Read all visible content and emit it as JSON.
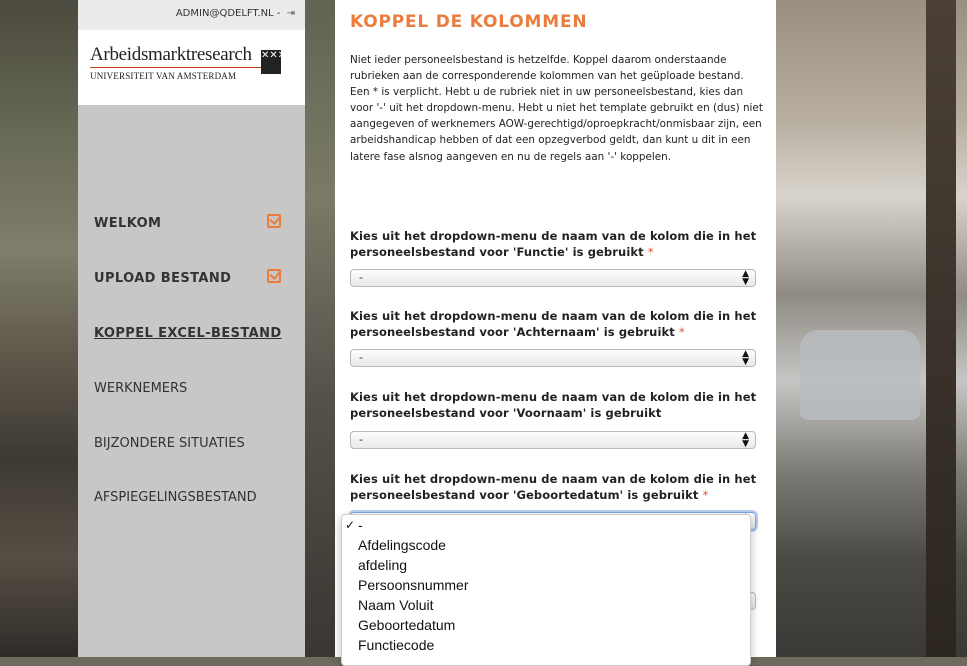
{
  "header": {
    "user": "ADMIN@QDELFT.NL -",
    "logout_icon": "logout-icon"
  },
  "logo": {
    "title": "Arbeidsmarktresearch",
    "subtitle": "UNIVERSITEIT VAN AMSTERDAM",
    "emblem": "✕✕✕"
  },
  "nav": {
    "items": [
      {
        "label": "WELKOM",
        "checked": true
      },
      {
        "label": "UPLOAD BESTAND",
        "checked": true
      },
      {
        "label": "KOPPEL EXCEL-BESTAND",
        "active": true
      },
      {
        "label": "WERKNEMERS"
      },
      {
        "label": "BIJZONDERE SITUATIES"
      },
      {
        "label": "AFSPIEGELINGSBESTAND"
      }
    ]
  },
  "main": {
    "title": "KOPPEL DE KOLOMMEN",
    "intro": "Niet ieder personeelsbestand is hetzelfde. Koppel daarom onderstaande rubrieken aan de corresponderende kolommen van het geüploade bestand. Een * is verplicht. Hebt u de rubriek niet in uw personeelsbestand, kies dan voor '-' uit het dropdown-menu. Hebt u niet het template gebruikt en (dus) niet aangegeven of werknemers AOW-gerechtigd/oproepkracht/onmisbaar zijn, een arbeidshandicap hebben of dat een opzegverbod geldt, dan kunt u dit in een latere fase alsnog aangeven en nu de regels aan '-' koppelen.",
    "fields": [
      {
        "label": "Kies uit het dropdown-menu de naam van de kolom die in het personeelsbestand voor 'Functie' is gebruikt",
        "required": "*",
        "value": "-"
      },
      {
        "label": "Kies uit het dropdown-menu de naam van de kolom die in het personeelsbestand voor 'Achternaam' is gebruikt",
        "required": "*",
        "value": "-"
      },
      {
        "label": "Kies uit het dropdown-menu de naam van de kolom die in het personeelsbestand voor 'Voornaam' is gebruikt",
        "required": "",
        "value": "-"
      },
      {
        "label": "Kies uit het dropdown-menu de naam van de kolom die in het personeelsbestand voor 'Geboortedatum' is gebruikt",
        "required": "*",
        "value": "-"
      }
    ]
  },
  "dropdown": {
    "options": [
      "-",
      "Afdelingscode",
      "afdeling",
      "Persoonsnummer",
      "Naam Voluit",
      "Geboortedatum",
      "Functiecode"
    ],
    "selected_index": 0,
    "check": "✓"
  },
  "colors": {
    "accent": "#ea7d3e",
    "required": "#e24b2a"
  }
}
